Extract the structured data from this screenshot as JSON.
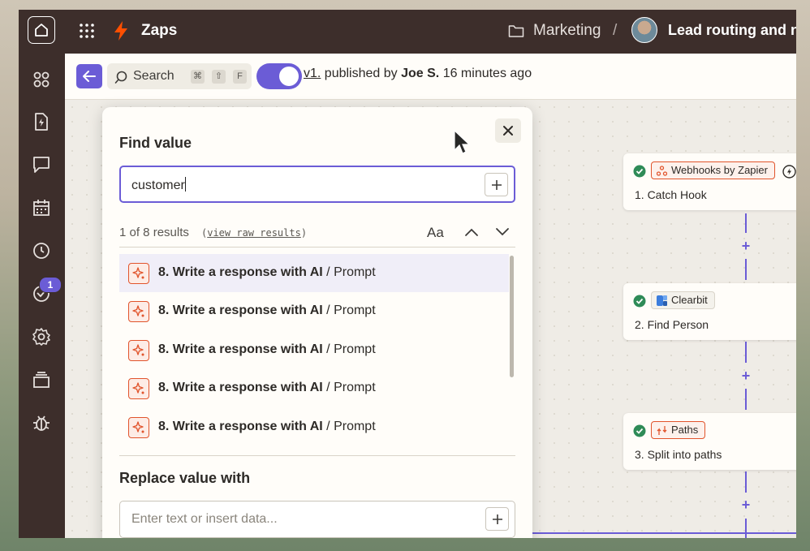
{
  "header": {
    "brand": "Zaps",
    "folder": "Marketing",
    "separator": "/",
    "zap_name": "Lead routing and nu"
  },
  "sidebar": {
    "items": [
      "apps",
      "zaps",
      "interfaces",
      "tables",
      "history",
      "canvas",
      "settings",
      "templates",
      "debug"
    ],
    "badge_count": "1"
  },
  "toolbar": {
    "search_label": "Search",
    "shortcut_keys": [
      "⌘",
      "⇧",
      "F"
    ],
    "version": "v1.",
    "published_by_text": "published by",
    "author": "Joe S.",
    "time_ago": "16 minutes ago"
  },
  "find_dialog": {
    "title": "Find value",
    "find_value": "customer",
    "results_count": "1 of 8 results",
    "view_raw_link": "view raw results",
    "match_case_label": "Aa",
    "results": [
      {
        "step": "8. Write a response with AI",
        "field": "Prompt"
      },
      {
        "step": "8. Write a response with AI",
        "field": "Prompt"
      },
      {
        "step": "8. Write a response with AI",
        "field": "Prompt"
      },
      {
        "step": "8. Write a response with AI",
        "field": "Prompt"
      },
      {
        "step": "8. Write a response with AI",
        "field": "Prompt"
      }
    ],
    "replace_title": "Replace value with",
    "replace_placeholder": "Enter text or insert data..."
  },
  "canvas": {
    "steps": [
      {
        "app": "Webhooks by Zapier",
        "title": "1. Catch Hook"
      },
      {
        "app": "Clearbit",
        "title": "2. Find Person"
      },
      {
        "app": "Paths",
        "title": "3. Split into paths"
      }
    ],
    "plus_label": "+"
  },
  "colors": {
    "accent": "#6b5cd6",
    "topbar": "#3d2e2b",
    "brand_bolt": "#ff4f00",
    "ai_orange": "#e1542c",
    "success": "#2e8b57"
  }
}
